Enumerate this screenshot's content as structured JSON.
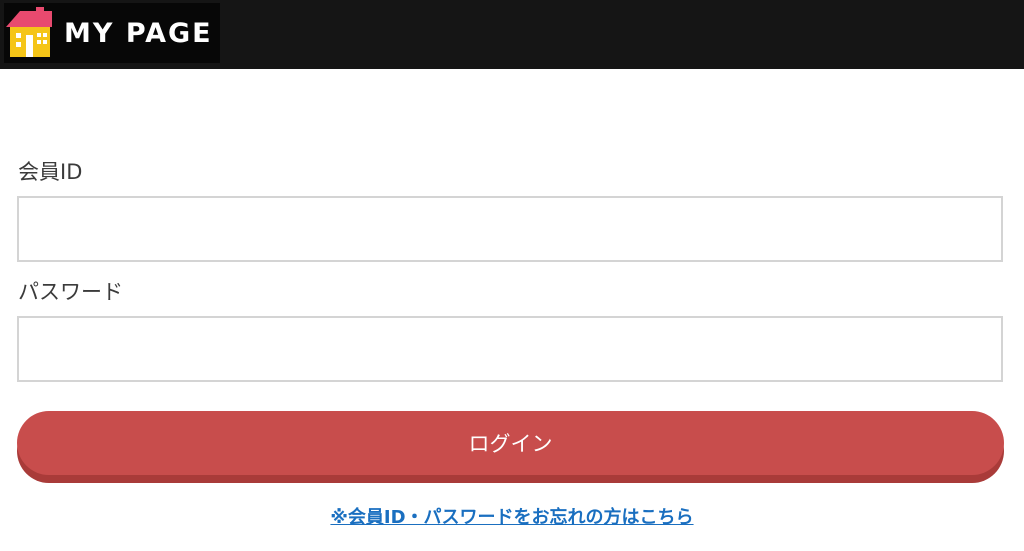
{
  "header": {
    "logo_text": "MY PAGE",
    "logo_icon": "house-icon",
    "colors": {
      "bar": "#151515",
      "roof": "#e84a6f",
      "house": "#f5c518"
    }
  },
  "form": {
    "member_id_label": "会員ID",
    "member_id_value": "",
    "password_label": "パスワード",
    "password_value": "",
    "login_button": "ログイン",
    "forgot_link": "※会員ID・パスワードをお忘れの方はこちら"
  },
  "colors": {
    "button": "#c84d4c",
    "button_shadow": "#a93b39",
    "link": "#1a6fc0"
  }
}
